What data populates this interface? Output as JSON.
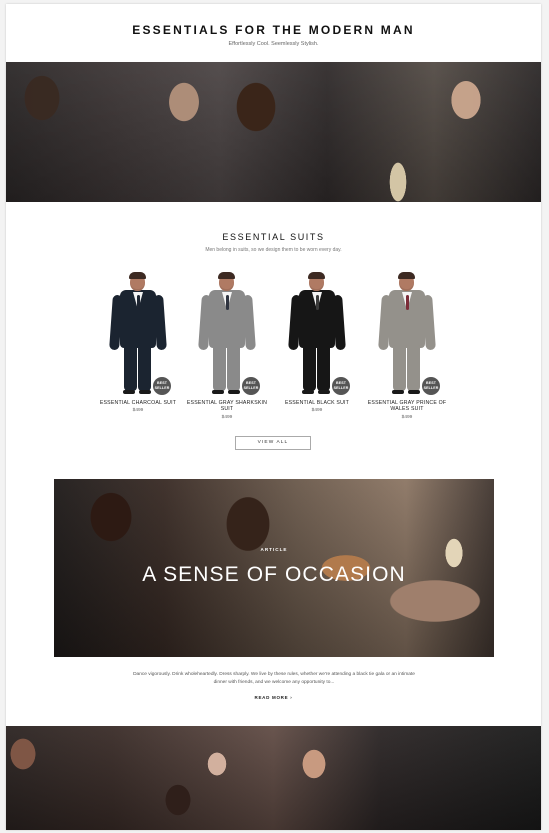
{
  "header": {
    "title": "ESSENTIALS FOR THE MODERN MAN",
    "subtitle": "Effortlessly Cool. Seemlessly Stylish."
  },
  "suits": {
    "title": "ESSENTIAL SUITS",
    "subtitle": "Men belong in suits, so we design them to be worn every day.",
    "products": [
      {
        "name": "ESSENTIAL CHARCOAL SUIT",
        "price": "$499",
        "badge": "BEST SELLER",
        "suit_color": "#1b2430",
        "tie_color": "#1d2430"
      },
      {
        "name": "ESSENTIAL GRAY SHARKSKIN SUIT",
        "price": "$499",
        "badge": "BEST SELLER",
        "suit_color": "#8a8a8a",
        "tie_color": "#2f3440"
      },
      {
        "name": "ESSENTIAL BLACK SUIT",
        "price": "$499",
        "badge": "BEST SELLER",
        "suit_color": "#161616",
        "tie_color": "#3b3b3b"
      },
      {
        "name": "ESSENTIAL GRAY PRINCE OF WALES SUIT",
        "price": "$499",
        "badge": "BEST SELLER",
        "suit_color": "#94918b",
        "tie_color": "#7b2c38"
      }
    ],
    "view_all": "VIEW ALL"
  },
  "article": {
    "label": "ARTICLE",
    "title": "A SENSE OF OCCASION",
    "excerpt": "Dance vigorously. Drink wholeheartedly. Dress sharply. We live by these rules, whether we're attending a black tie gala or an intimate dinner with friends, and we welcome any opportunity to...",
    "read_more": "READ MORE"
  },
  "icons": {
    "read_more_arrow": "chevron-right-icon"
  }
}
